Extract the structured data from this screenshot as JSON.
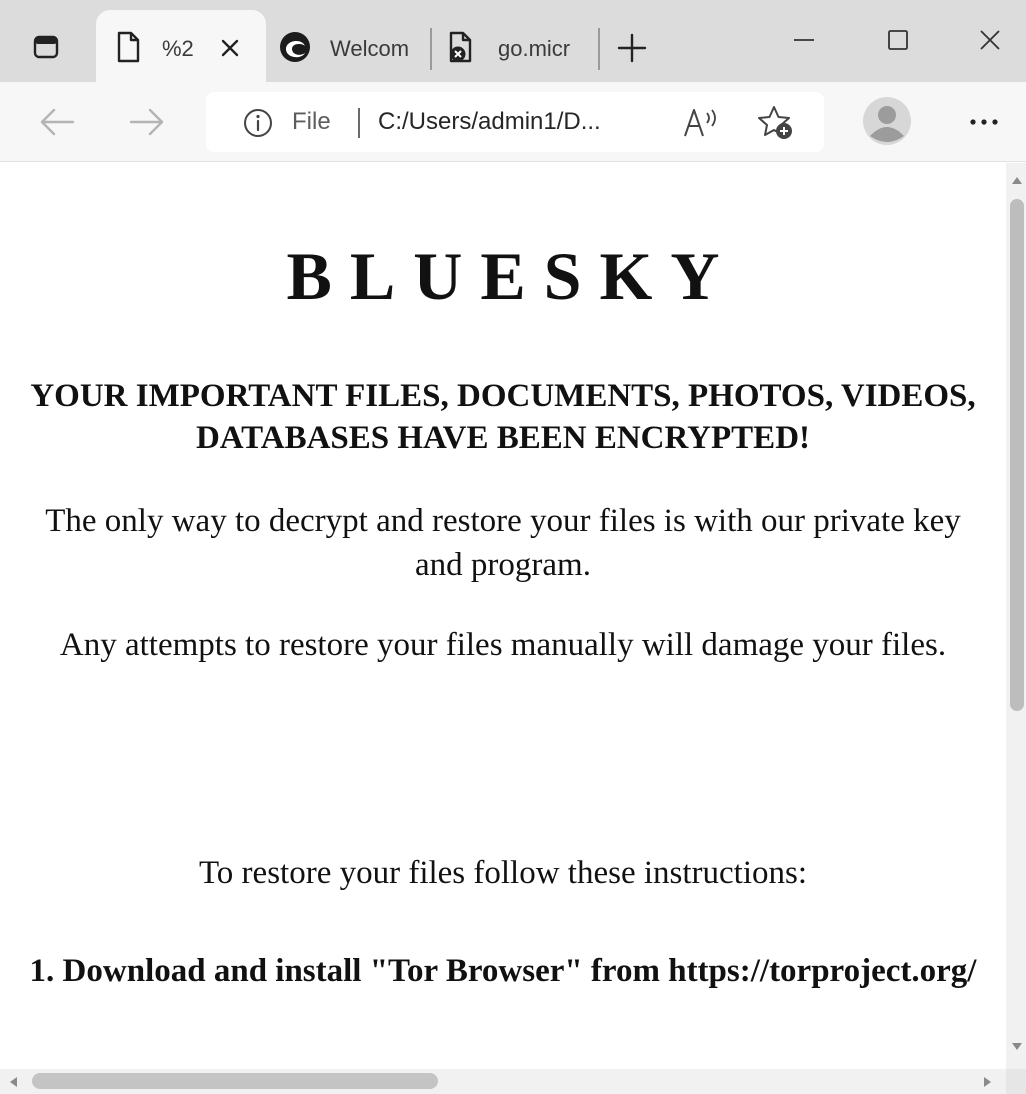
{
  "browser": {
    "tabs": [
      {
        "title": "%2",
        "active": true
      },
      {
        "title": "Welcom",
        "active": false
      },
      {
        "title": "go.micr",
        "active": false
      }
    ],
    "address": {
      "scheme_label": "File",
      "url": "C:/Users/admin1/D..."
    },
    "icons": {
      "tab_actions": "tab-actions-icon",
      "page_favicon": "page-icon",
      "welcome_favicon": "edge-icon",
      "blocked_favicon": "blocked-page-icon",
      "new_tab": "plus-icon",
      "back": "arrow-left-icon",
      "forward": "arrow-right-icon",
      "info": "info-icon",
      "read_aloud": "read-aloud-icon",
      "favorites": "star-add-icon",
      "profile": "profile-icon",
      "more": "more-icon"
    },
    "colors": {
      "tabstrip": "#dcdcdc",
      "toolbar": "#f7f7f7",
      "page": "#ffffff",
      "text": "#111111"
    }
  },
  "page": {
    "brand": "BLUESKY",
    "headline": "YOUR IMPORTANT FILES, DOCUMENTS, PHOTOS, VIDEOS, DATABASES HAVE BEEN ENCRYPTED!",
    "paragraphs": [
      "The only way to decrypt and restore your files is with our private key and program.",
      "Any attempts to restore your files manually will damage your files.",
      "To restore your files follow these instructions:"
    ],
    "steps": [
      "1. Download and install \"Tor Browser\" from https://torproject.org/"
    ]
  }
}
